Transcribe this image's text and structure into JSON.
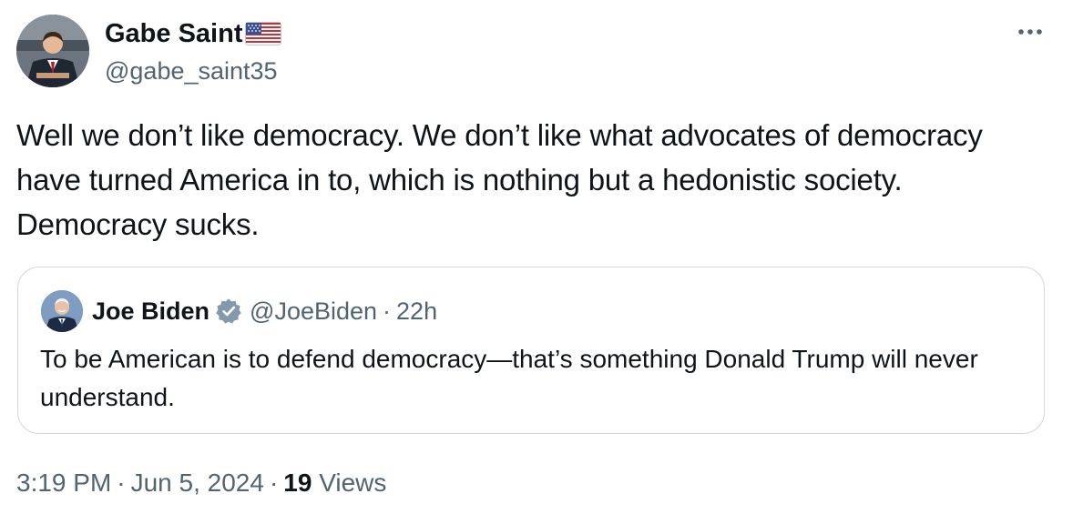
{
  "tweet": {
    "author": {
      "name": "Gabe Saint",
      "handle": "@gabe_saint35",
      "flag_icon": "us-flag-icon"
    },
    "more_icon": "more-horizontal-icon",
    "text": "Well we don’t like democracy. We don’t like what advocates of democracy have turned America in to, which is nothing but a hedonistic society. Democracy sucks.",
    "quoted_tweet": {
      "author_name": "Joe Biden",
      "verified_icon": "verified-badge-icon",
      "handle": "@JoeBiden",
      "separator": "·",
      "time": "22h",
      "text": "To be American is to defend democracy—that’s something Donald Trump will never understand."
    },
    "meta": {
      "time": "3:19 PM",
      "separator": "·",
      "date": "Jun 5, 2024",
      "views_count": "19",
      "views_label": "Views"
    }
  },
  "colors": {
    "text_primary": "#0f1419",
    "text_secondary": "#536471",
    "border": "#cfd9de",
    "verified_badge": "#829aab"
  }
}
